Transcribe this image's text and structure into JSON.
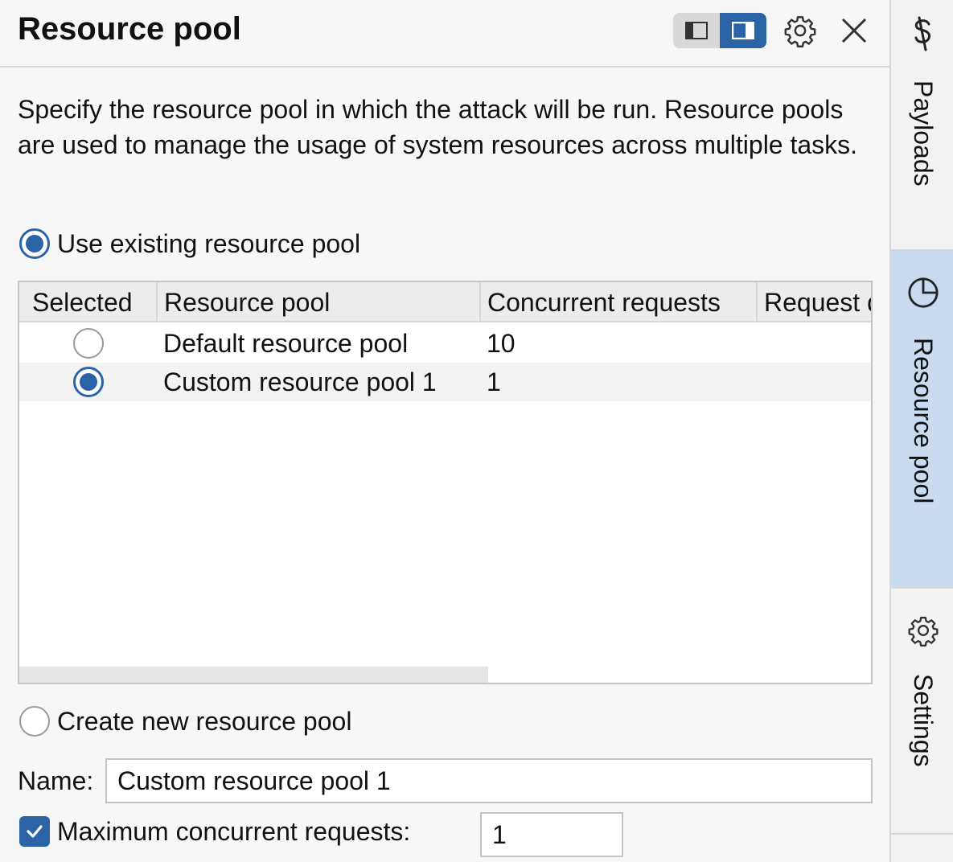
{
  "header": {
    "title": "Resource pool",
    "layout_toggle": [
      "layout-left-icon",
      "layout-right-icon"
    ],
    "settings_icon": "gear-icon",
    "close_icon": "close-icon"
  },
  "description": "Specify the resource pool in which the attack will be run. Resource pools are used to manage the usage of system resources across multiple tasks.",
  "use_existing": {
    "label": "Use existing resource pool",
    "checked": true
  },
  "table": {
    "columns": [
      "Selected",
      "Resource pool",
      "Concurrent requests",
      "Request d"
    ],
    "rows": [
      {
        "selected": false,
        "name": "Default resource pool",
        "concurrent": "10"
      },
      {
        "selected": true,
        "name": "Custom resource pool 1",
        "concurrent": "1"
      }
    ]
  },
  "create_new": {
    "label": "Create new resource pool",
    "checked": false
  },
  "name_field": {
    "label": "Name:",
    "value": "Custom resource pool 1"
  },
  "max_concurrent": {
    "label": "Maximum concurrent requests:",
    "checked": true,
    "value": "1"
  },
  "sidebar": {
    "tabs": [
      {
        "label": "Payloads",
        "icon": "dollar-sign-icon",
        "active": false
      },
      {
        "label": "Resource pool",
        "icon": "pie-chart-icon",
        "active": true
      },
      {
        "label": "Settings",
        "icon": "gear-icon",
        "active": false
      }
    ]
  },
  "colors": {
    "accent": "#2a64a6",
    "active_tab": "#c9dbf1"
  }
}
